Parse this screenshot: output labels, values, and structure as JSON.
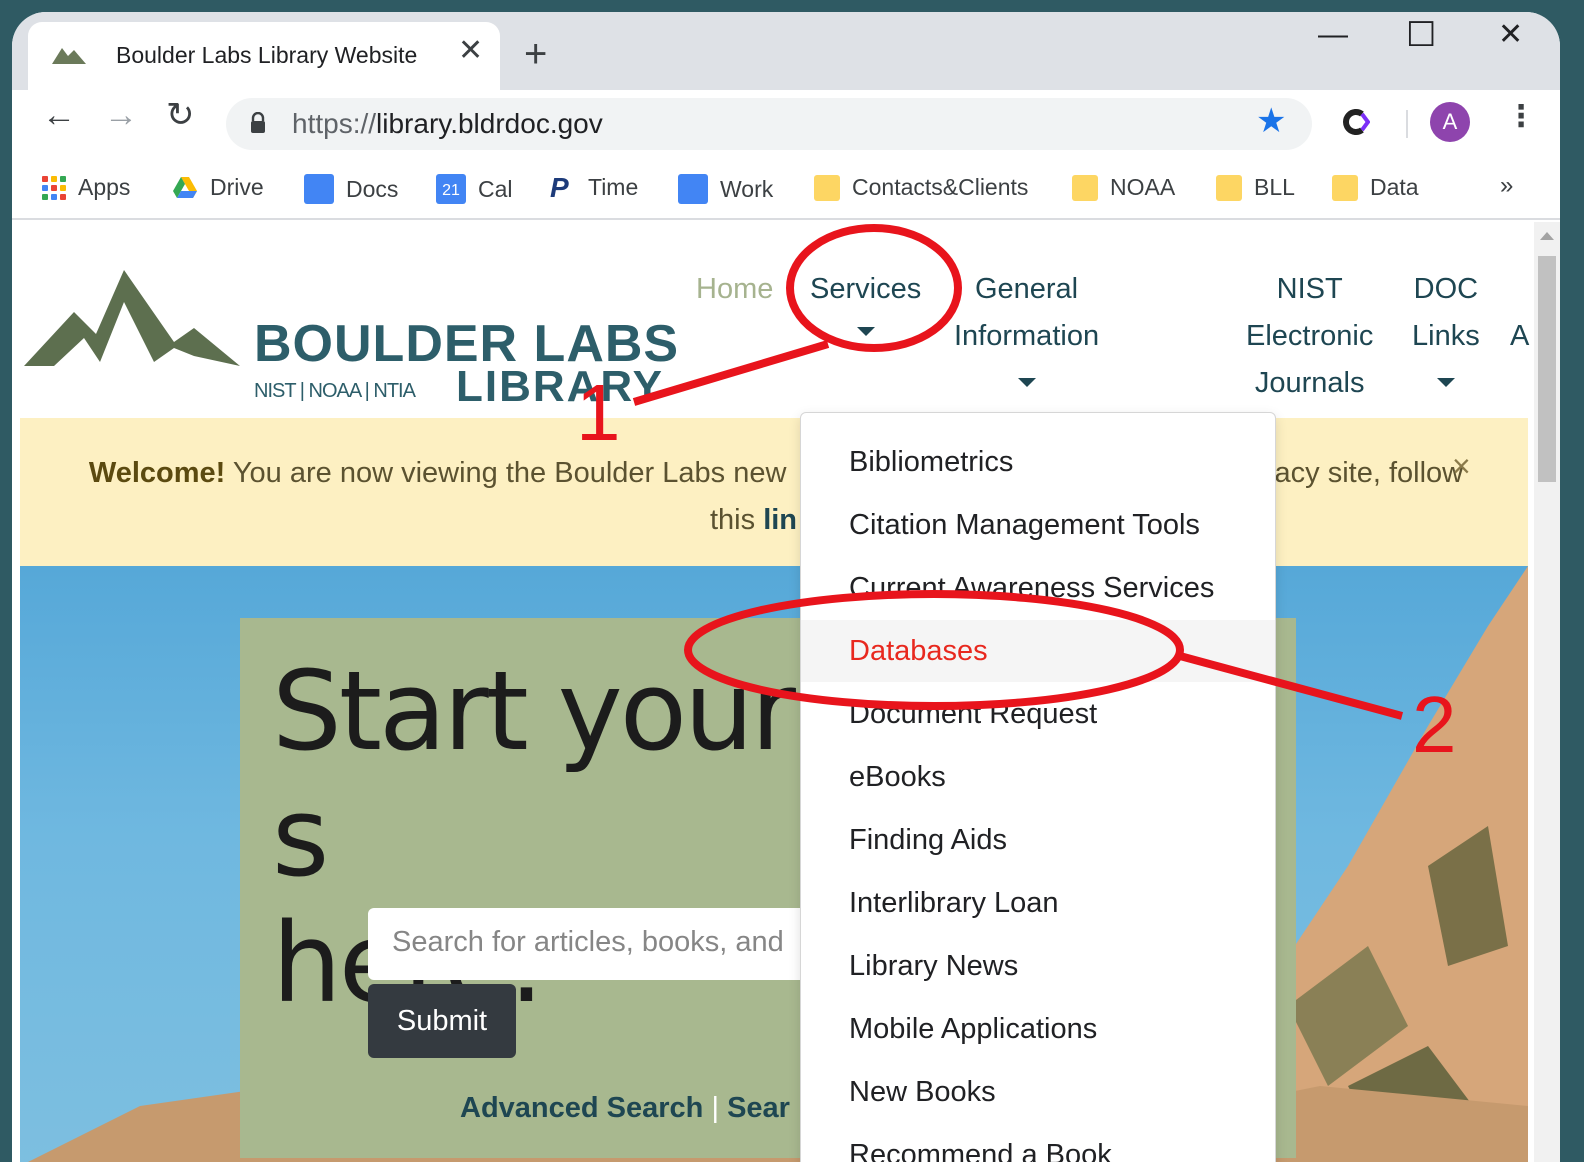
{
  "browser": {
    "tab_title": "Boulder Labs Library Website",
    "tab_close": "✕",
    "new_tab": "+",
    "minimize": "—",
    "maximize": "☐",
    "close": "✕",
    "back": "←",
    "forward": "→",
    "reload": "↻",
    "url_scheme": "https://",
    "url_host": "library.bldrdoc.gov",
    "star": "★",
    "avatar_letter": "A",
    "menu": "⋮",
    "bookmarks_more": "»"
  },
  "bookmarks": [
    {
      "label": "Apps",
      "icon": "apps-icon"
    },
    {
      "label": "Drive",
      "icon": "drive-icon"
    },
    {
      "label": "Docs",
      "icon": "docs-icon"
    },
    {
      "label": "Cal",
      "icon": "calendar-icon",
      "icon_text": "21"
    },
    {
      "label": "Time",
      "icon": "time-icon",
      "icon_text": "P"
    },
    {
      "label": "Work",
      "icon": "docs-icon"
    },
    {
      "label": "Contacts&Clients",
      "icon": "folder-icon"
    },
    {
      "label": "NOAA",
      "icon": "folder-icon"
    },
    {
      "label": "BLL",
      "icon": "folder-icon"
    },
    {
      "label": "Data",
      "icon": "folder-icon"
    }
  ],
  "site": {
    "logo_title": "BOULDER LABS",
    "logo_sub": "NIST | NOAA | NTIA",
    "logo_library": "LIBRARY",
    "nav": {
      "home": "Home",
      "services": "Services",
      "general_1": "General",
      "general_2": "Information",
      "nist_1": "NIST",
      "nist_2": "Electronic",
      "nist_3": "Journals",
      "doc_1": "DOC",
      "doc_2": "Links",
      "cut": "A"
    },
    "banner": {
      "welcome": "Welcome!",
      "text_left": " You are now viewing the Boulder Labs new",
      "text_right": "gacy site, follow",
      "line2_a": "this ",
      "line2_link": "lin",
      "close": "×"
    },
    "hero_title_1": "Start your s",
    "hero_title_2": "here:",
    "search_placeholder": "Search for articles, books, and",
    "submit": "Submit",
    "advanced_search": "Advanced Search",
    "link_sep": "|",
    "search_cut": "Sear"
  },
  "dropdown": {
    "items": [
      "Bibliometrics",
      "Citation Management Tools",
      "Current Awareness Services",
      "Databases",
      "Document Request",
      "eBooks",
      "Finding Aids",
      "Interlibrary Loan",
      "Library News",
      "Mobile Applications",
      "New Books",
      "Recommend a Book"
    ],
    "active": "Databases"
  },
  "annotations": {
    "step1": "1",
    "step2": "2",
    "color": "#e8141c"
  }
}
